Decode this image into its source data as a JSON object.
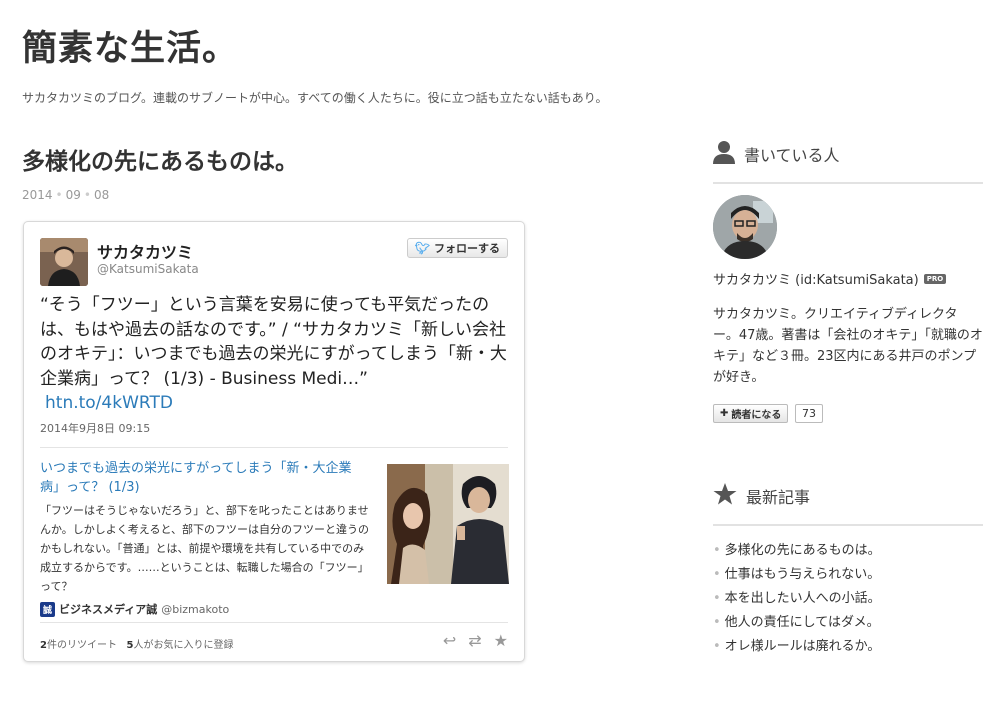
{
  "blog": {
    "title": "簡素な生活。",
    "description": "サカタカツミのブログ。連載のサブノートが中心。すべての働く人たちに。役に立つ話も立たない話もあり。"
  },
  "entry": {
    "title": "多様化の先にあるものは。",
    "date": {
      "year": "2014",
      "month": "09",
      "day": "08"
    }
  },
  "tweet": {
    "name": "サカタカツミ",
    "handle": "@KatsumiSakata",
    "follow_label": "フォローする",
    "text": "“そう「フツー」という言葉を安易に使っても平気だったのは、もはや過去の話なのです。” / “サカタカツミ「新しい会社のオキテ」：いつまでも過去の栄光にすがってしまう「新・大企業病」って？ (1/3) - Business Medi…”",
    "link": "htn.to/4kWRTD",
    "time": "2014年9月8日 09:15",
    "card": {
      "title": "いつまでも過去の栄光にすがってしまう「新・大企業病」って？ (1/3)",
      "description": "「フツーはそうじゃないだろう」と、部下を叱ったことはありませんか。しかしよく考えると、部下のフツーは自分のフツーと違うのかもしれない。「普通」とは、前提や環境を共有している中でのみ成立するからです。……ということは、転職した場合の「フツー」って？",
      "source_badge": "誠",
      "source_name": "ビジネスメディア誠",
      "source_account": "@bizmakoto"
    },
    "retweets": "2",
    "retweets_label": "件のリツイート",
    "favorites": "5",
    "favorites_label": "人がお気に入りに登録"
  },
  "sidebar": {
    "author_heading": "書いている人",
    "author_id": "サカタカツミ (id:KatsumiSakata)",
    "pro_label": "PRO",
    "author_bio": "サカタカツミ。クリエイティブディレクター。47歳。著書は「会社のオキテ」「就職のオキテ」など３冊。23区内にある井戸のポンプが好き。",
    "reader_button": "読者になる",
    "reader_count": "73",
    "recent_heading": "最新記事",
    "recent_posts": [
      "多様化の先にあるものは。",
      "仕事はもう与えられない。",
      "本を出したい人への小話。",
      "他人の責任にしてはダメ。",
      "オレ様ルールは廃れるか。"
    ]
  },
  "icons": {
    "person": "person-icon",
    "star": "star-icon",
    "twitter_bird": "twitter-bird-icon",
    "reply": "reply-icon",
    "retweet": "retweet-icon",
    "favorite": "favorite-icon",
    "plus": "plus-icon"
  },
  "colors": {
    "link": "#2b7bb9",
    "twitter": "#55acee"
  }
}
